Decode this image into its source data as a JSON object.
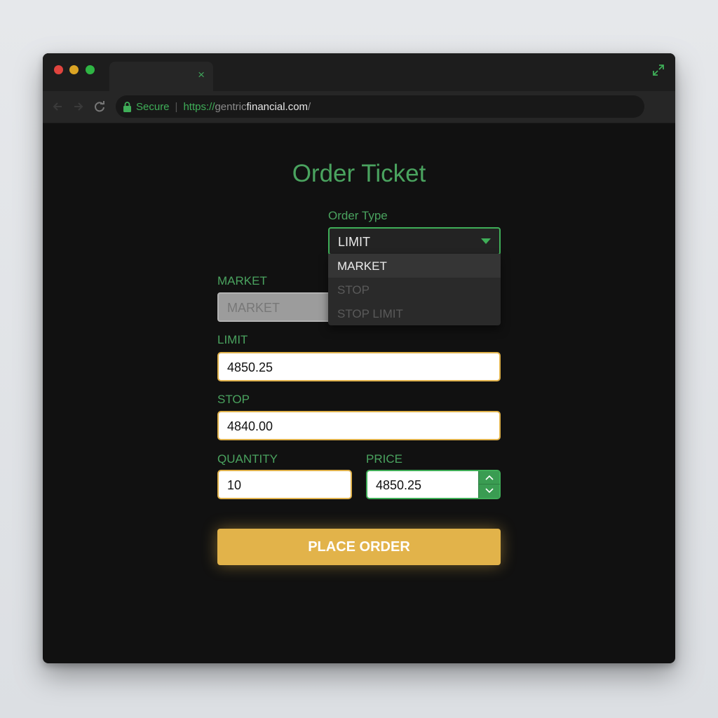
{
  "browser": {
    "tab_close_glyph": "×",
    "address": {
      "secure_label": "Secure",
      "separator": "|",
      "scheme": "https://",
      "subdomain": "gentric",
      "host": "financial.com",
      "path": "/"
    }
  },
  "page": {
    "title": "Order Ticket",
    "order_type": {
      "label": "Order Type",
      "selected": "LIMIT",
      "options": [
        "MARKET",
        "STOP",
        "STOP LIMIT"
      ]
    },
    "market": {
      "label": "MARKET",
      "placeholder": "MARKET"
    },
    "limit": {
      "label": "LIMIT",
      "value": "4850.25"
    },
    "stop": {
      "label": "STOP",
      "value": "4840.00"
    },
    "quantity": {
      "label": "QUANTITY",
      "value": "10"
    },
    "price": {
      "label": "PRICE",
      "value": "4850.25"
    },
    "submit_label": "PLACE ORDER"
  },
  "colors": {
    "accent_green": "#3fae58",
    "accent_gold": "#e2b34a",
    "background": "#111111"
  }
}
